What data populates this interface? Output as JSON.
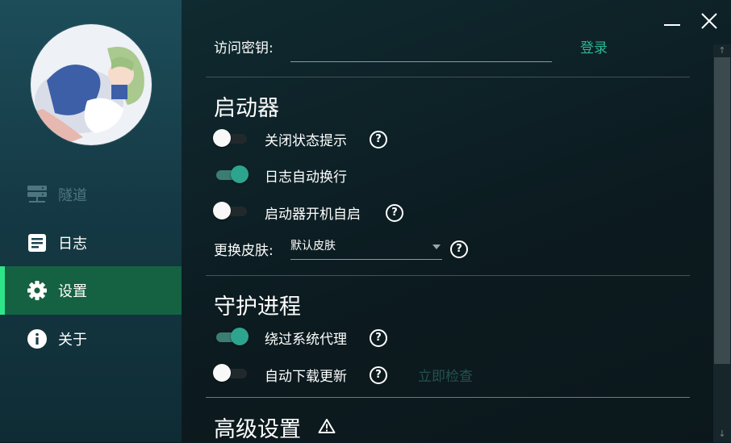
{
  "sidebar": {
    "avatar": "anime-girl-avatar",
    "items": [
      {
        "label": "隧道",
        "icon": "server-icon",
        "state": "disabled"
      },
      {
        "label": "日志",
        "icon": "log-icon",
        "state": "normal"
      },
      {
        "label": "设置",
        "icon": "gear-icon",
        "state": "active"
      },
      {
        "label": "关于",
        "icon": "info-icon",
        "state": "normal"
      }
    ]
  },
  "window": {
    "minimize_icon": "minimize-icon",
    "close_icon": "close-icon"
  },
  "access_key": {
    "label": "访问密钥:",
    "value": "",
    "login_label": "登录"
  },
  "launcher": {
    "title": "启动器",
    "options": [
      {
        "label": "关闭状态提示",
        "on": false,
        "help": true
      },
      {
        "label": "日志自动换行",
        "on": true,
        "help": false
      },
      {
        "label": "启动器开机自启",
        "on": false,
        "help": true
      }
    ],
    "skin": {
      "label": "更换皮肤:",
      "value": "默认皮肤"
    }
  },
  "daemon": {
    "title": "守护进程",
    "options": [
      {
        "label": "绕过系统代理",
        "on": true,
        "help": true
      },
      {
        "label": "自动下载更新",
        "on": false,
        "help": true
      }
    ],
    "check_now_label": "立即检查"
  },
  "advanced": {
    "title": "高级设置",
    "icon": "warning-icon"
  },
  "help_glyph": "?",
  "colors": {
    "accent": "#2da58e",
    "active_nav": "#156242",
    "active_bar": "#2ee58a"
  }
}
